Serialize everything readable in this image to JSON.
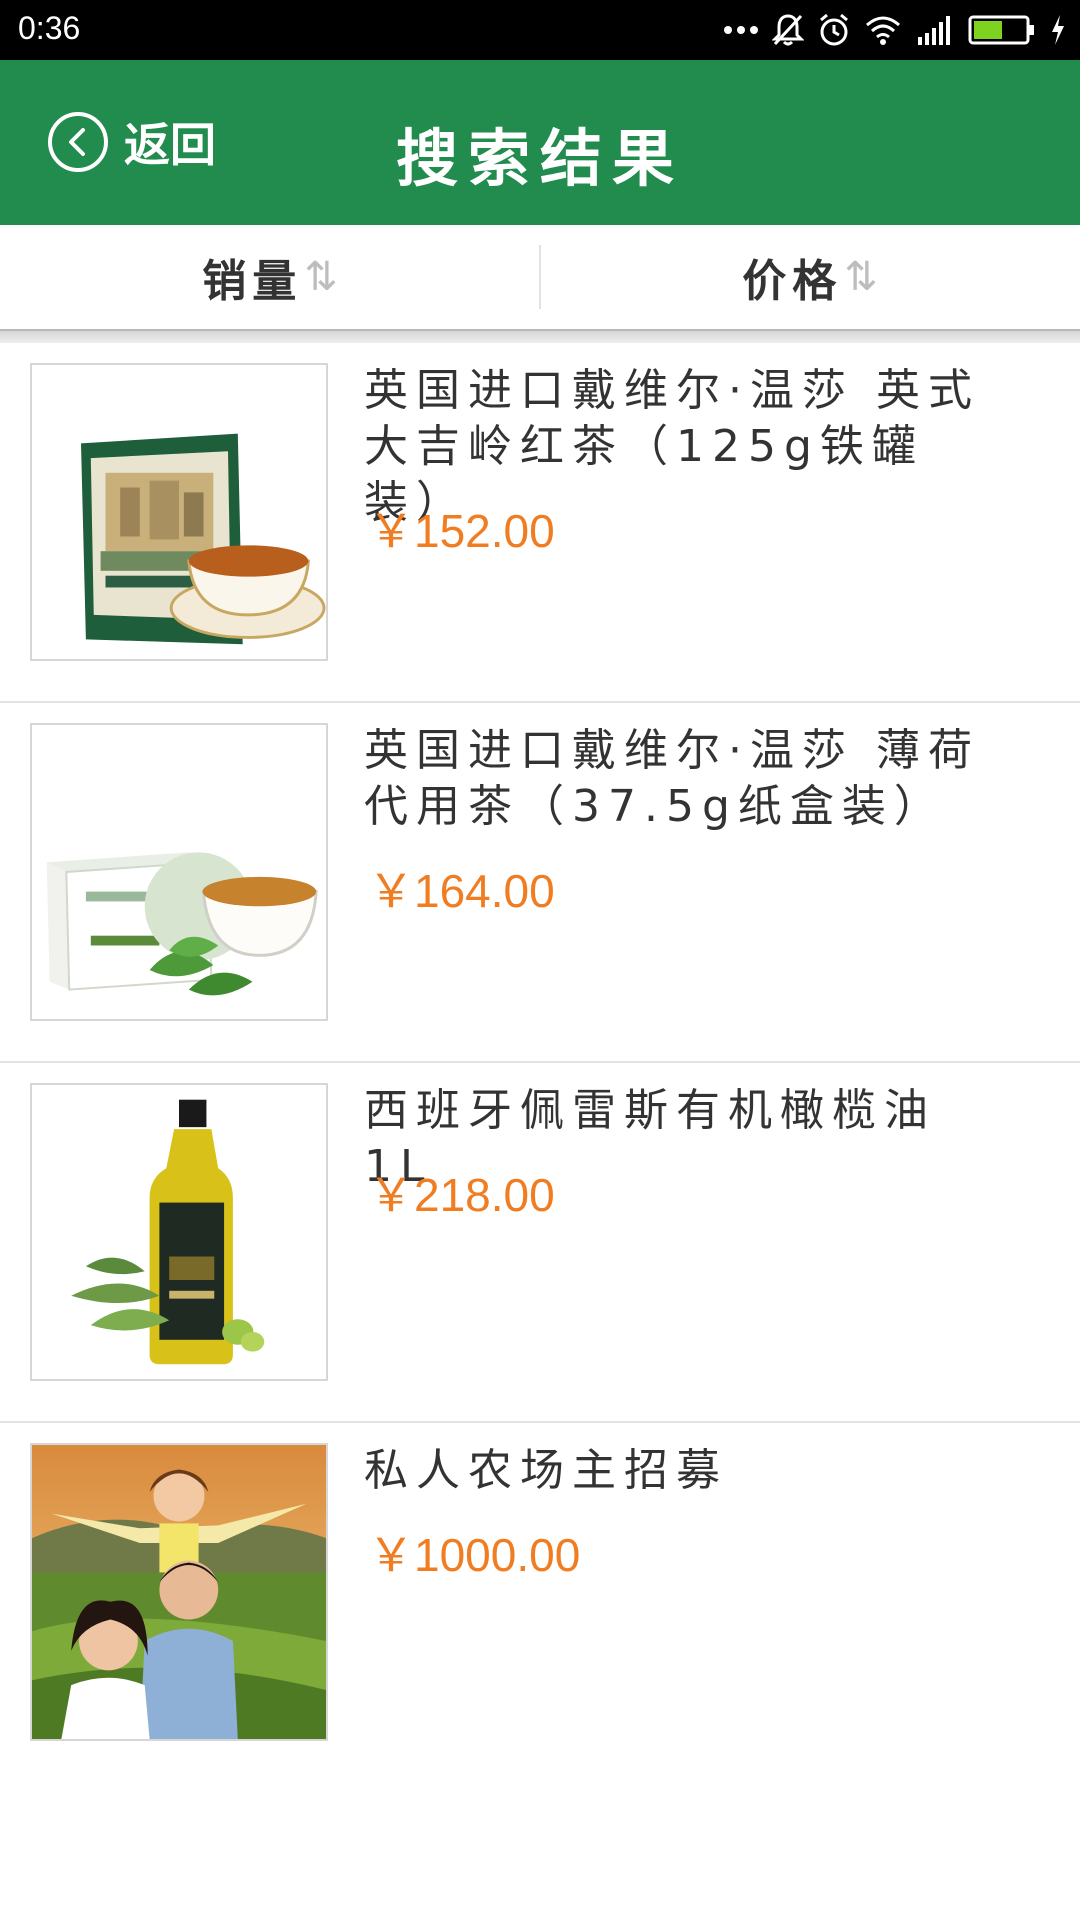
{
  "status_bar": {
    "time": "0:36"
  },
  "header": {
    "back_label": "返回",
    "title": "搜索结果"
  },
  "sort": {
    "sales_label": "销量",
    "price_label": "价格",
    "arrows": "⇅"
  },
  "products": [
    {
      "name": "英国进口戴维尔·温莎 英式大吉岭红茶（125g铁罐装）",
      "price": "￥152.00",
      "image": "darjeeling-tea-tin"
    },
    {
      "name": "英国进口戴维尔·温莎 薄荷代用茶（37.5g纸盒装）",
      "price": "￥164.00",
      "image": "peppermint-tea-box"
    },
    {
      "name": "西班牙佩雷斯有机橄榄油1L",
      "price": "￥218.00",
      "image": "olive-oil-bottle"
    },
    {
      "name": "私人农场主招募",
      "price": "￥1000.00",
      "image": "family-farm-photo"
    }
  ],
  "colors": {
    "header": "#228b4e",
    "price": "#f07d22"
  }
}
